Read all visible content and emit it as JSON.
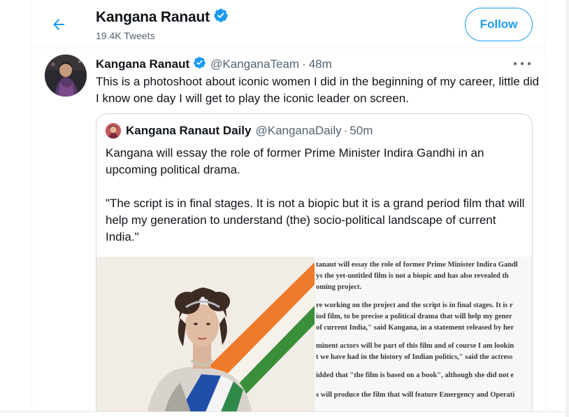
{
  "header": {
    "title": "Kangana Ranaut",
    "subtitle": "19.4K Tweets",
    "follow_label": "Follow"
  },
  "tweet": {
    "name": "Kangana Ranaut",
    "handle": "@KanganaTeam",
    "separator": "·",
    "time": "48m",
    "text": "This is a photoshoot about iconic women I did in the beginning of my career, little did I know one day I will get to play the iconic leader on screen."
  },
  "quoted": {
    "name": "Kangana Ranaut Daily",
    "handle": "@KanganaDaily",
    "separator": "·",
    "time": "50m",
    "paragraph1": "Kangana will essay the role of former Prime Minister Indira Gandhi in an upcoming political drama.",
    "paragraph2": "\"The script is in final stages. It is not a biopic but it is a grand period film that will help my generation to understand (the) socio-political landscape of current India.\""
  },
  "article_lines": [
    "tanaut will essay the role of former Prime Minister Indira Gandl",
    "ys the yet-untitled film is not a biopic and has also revealed th",
    "oming project.",
    "re working on the project and the script is in final stages. It is r",
    "iod film, to be precise a political drama that will help my gener",
    "of current India,\" said Kangana, in a statement released by her",
    "minent actors will be part of this film and of course I am lookin",
    "t we have had in the history of Indian politics,\" said the actress",
    "idded that \"the film is based on a book\", although she did not e",
    "s will produce the film that will feature Emergency and Operati"
  ],
  "icons": {
    "back": "back-arrow-icon",
    "verified": "verified-badge-icon",
    "more": "more-options-icon"
  },
  "colors": {
    "accent": "#1d9bf0",
    "text_primary": "#0f1419",
    "text_secondary": "#536471",
    "border": "#cfd9de"
  }
}
